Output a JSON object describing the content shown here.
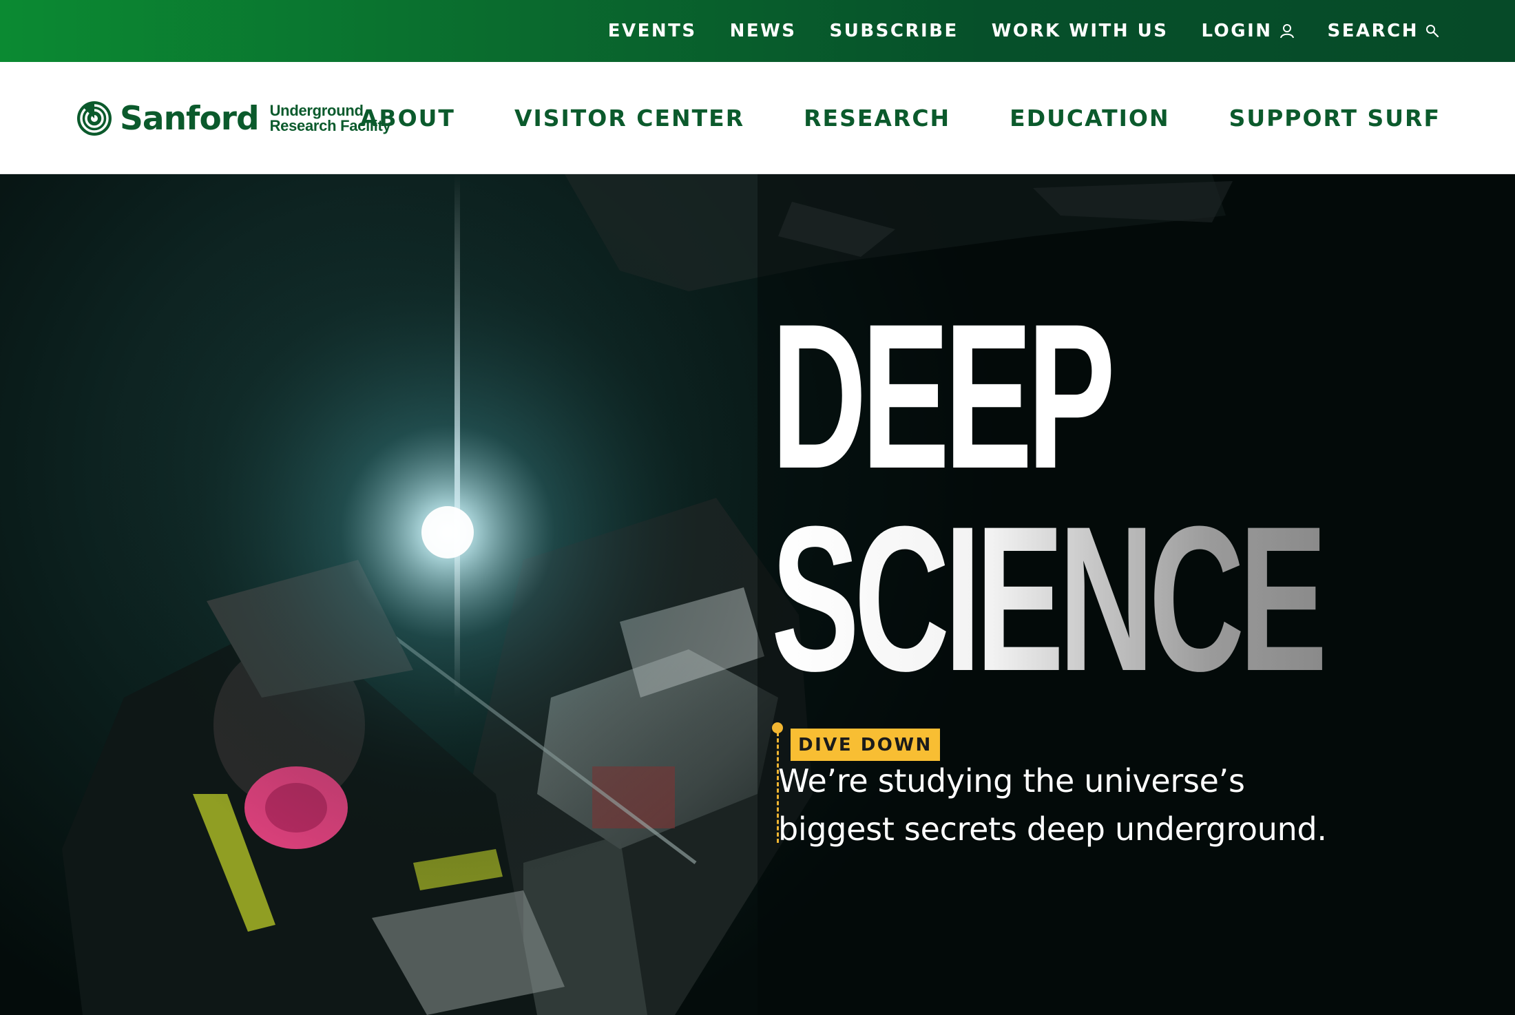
{
  "utility_nav": {
    "items": [
      {
        "label": "EVENTS"
      },
      {
        "label": "NEWS"
      },
      {
        "label": "SUBSCRIBE"
      },
      {
        "label": "WORK WITH US"
      },
      {
        "label": "LOGIN",
        "icon": "user-icon"
      },
      {
        "label": "SEARCH",
        "icon": "search-icon"
      }
    ]
  },
  "brand": {
    "name": "Sanford",
    "subtitle_line1": "Underground",
    "subtitle_line2": "Research Facility",
    "color": "#0b5a2c"
  },
  "main_nav": {
    "items": [
      {
        "label": "ABOUT"
      },
      {
        "label": "VISITOR CENTER"
      },
      {
        "label": "RESEARCH"
      },
      {
        "label": "EDUCATION"
      },
      {
        "label": "SUPPORT SURF"
      }
    ]
  },
  "hero": {
    "headline_line1": "DEEP",
    "headline_line2": "SCIENCE",
    "tagline_line1": "We’re studying the universe’s",
    "tagline_line2": "biggest secrets deep underground.",
    "cta_label": "DIVE DOWN",
    "cta_color": "#f8be33"
  },
  "colors": {
    "utility_bar_start": "#0b8a32",
    "utility_bar_end": "#064a28",
    "nav_text": "#0b5a2c",
    "hero_background": "#05110f"
  }
}
